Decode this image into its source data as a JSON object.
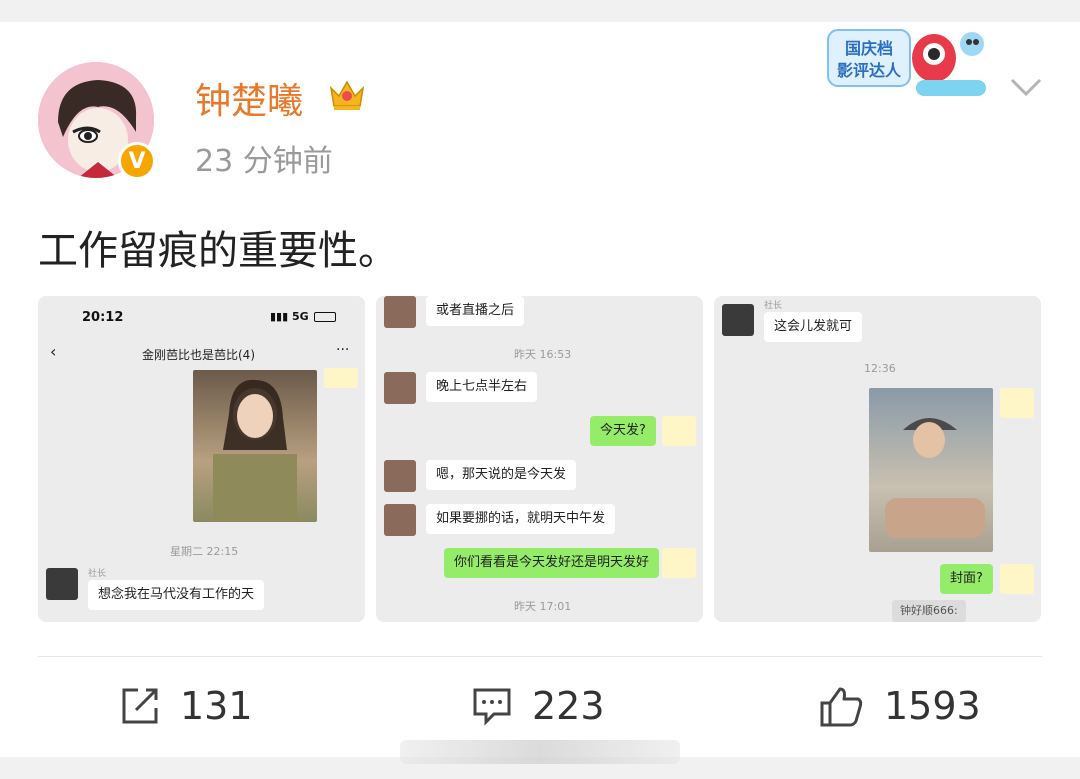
{
  "post": {
    "username": "钟楚曦",
    "time": "23 分钟前",
    "text": "工作留痕的重要性。",
    "avatar_badge": "V",
    "crown_icon": "crown-icon",
    "campaign_badge": {
      "line1": "国庆档",
      "line2": "影评达人"
    }
  },
  "screenshot1": {
    "status_time": "20:12",
    "network": "5G",
    "chat_title": "金刚芭比也是芭比(4)",
    "timestamp": "星期二 22:15",
    "sender_name": "社长",
    "msg": "想念我在马代没有工作的天"
  },
  "screenshot2": {
    "msg1": "或者直播之后",
    "ts1": "昨天 16:53",
    "msg2": "晚上七点半左右",
    "msg3": "今天发?",
    "msg4": "嗯，那天说的是今天发",
    "msg5": "如果要挪的话，就明天中午发",
    "msg6": "你们看看是今天发好还是明天发好",
    "ts2": "昨天 17:01"
  },
  "screenshot3": {
    "sender_name": "社长",
    "msg1": "这会儿发就可",
    "ts1": "12:36",
    "msg2": "封面?",
    "quote": "钟好顺666:"
  },
  "actions": {
    "repost_count": "131",
    "comment_count": "223",
    "like_count": "1593"
  },
  "colors": {
    "username": "#e8782a",
    "wechat_green": "#95ec69",
    "badge_orange": "#f7a600"
  }
}
